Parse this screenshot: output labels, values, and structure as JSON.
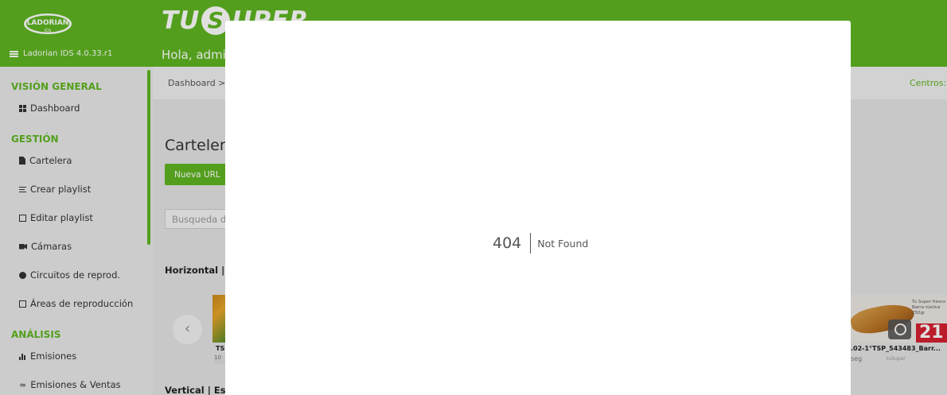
{
  "header": {
    "logo_text": "LADORIAN",
    "logo_sub": "IDS",
    "version": "Ladorian IDS 4.0.33.r1",
    "brand_left": "TU",
    "brand_s": "S",
    "brand_right": "UPER",
    "greeting": "Hola, admi"
  },
  "sidebar": {
    "sections": [
      {
        "title": "VISIÓN GENERAL",
        "items": [
          {
            "label": "Dashboard",
            "icon": "grid-icon"
          }
        ]
      },
      {
        "title": "GESTIÓN",
        "items": [
          {
            "label": "Cartelera",
            "icon": "document-icon"
          },
          {
            "label": "Crear playlist",
            "icon": "playlist-icon"
          },
          {
            "label": "Editar playlist",
            "icon": "edit-box-icon"
          },
          {
            "label": "Cámaras",
            "icon": "camera-icon"
          },
          {
            "label": "Circuitos de reprod.",
            "icon": "compass-icon"
          },
          {
            "label": "Áreas de reproducción",
            "icon": "area-box-icon"
          }
        ]
      },
      {
        "title": "ANÁLISIS",
        "items": [
          {
            "label": "Emisiones",
            "icon": "bar-chart-icon"
          },
          {
            "label": "Emisiones & Ventas",
            "icon": "trend-icon"
          }
        ]
      }
    ]
  },
  "main": {
    "breadcrumb": "Dashboard  >",
    "centros": "Centros:",
    "title": "Cartelera",
    "new_url_button": "Nueva URL",
    "search_placeholder": "Busqueda d",
    "row_horizontal": "Horizontal | Es",
    "row_vertical": "Vertical | Esp",
    "prev_arrow": "‹",
    "left_caption": "TS",
    "left_sub": "10",
    "right_caption": ".02-1°TSP_543483_Barr...",
    "right_sub": "seg",
    "right_brand": "tuSuper",
    "right_promo": "Tu Super fresco\nBarra rústica\n250gr",
    "right_price": "21",
    "accent_color": "#5fb521"
  },
  "modal": {
    "error_code": "404",
    "error_message": "Not Found"
  }
}
